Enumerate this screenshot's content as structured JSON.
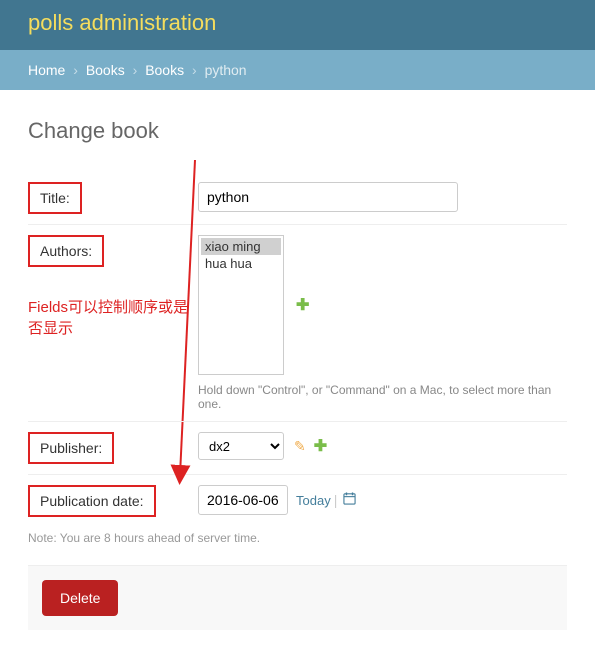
{
  "header": {
    "title": "polls administration"
  },
  "breadcrumbs": {
    "home": "Home",
    "app": "Books",
    "model": "Books",
    "current": "python"
  },
  "page_title": "Change book",
  "fields": {
    "title": {
      "label": "Title:",
      "value": "python"
    },
    "authors": {
      "label": "Authors:",
      "options": [
        "xiao ming",
        "hua hua"
      ],
      "selected_index": 0,
      "help": "Hold down \"Control\", or \"Command\" on a Mac, to select more than one."
    },
    "publisher": {
      "label": "Publisher:",
      "value": "dx2"
    },
    "pubdate": {
      "label": "Publication date:",
      "value": "2016-06-06",
      "today_label": "Today",
      "note": "Note: You are 8 hours ahead of server time."
    }
  },
  "annotation": "Fields可以控制顺序或是否显示",
  "buttons": {
    "delete": "Delete"
  }
}
